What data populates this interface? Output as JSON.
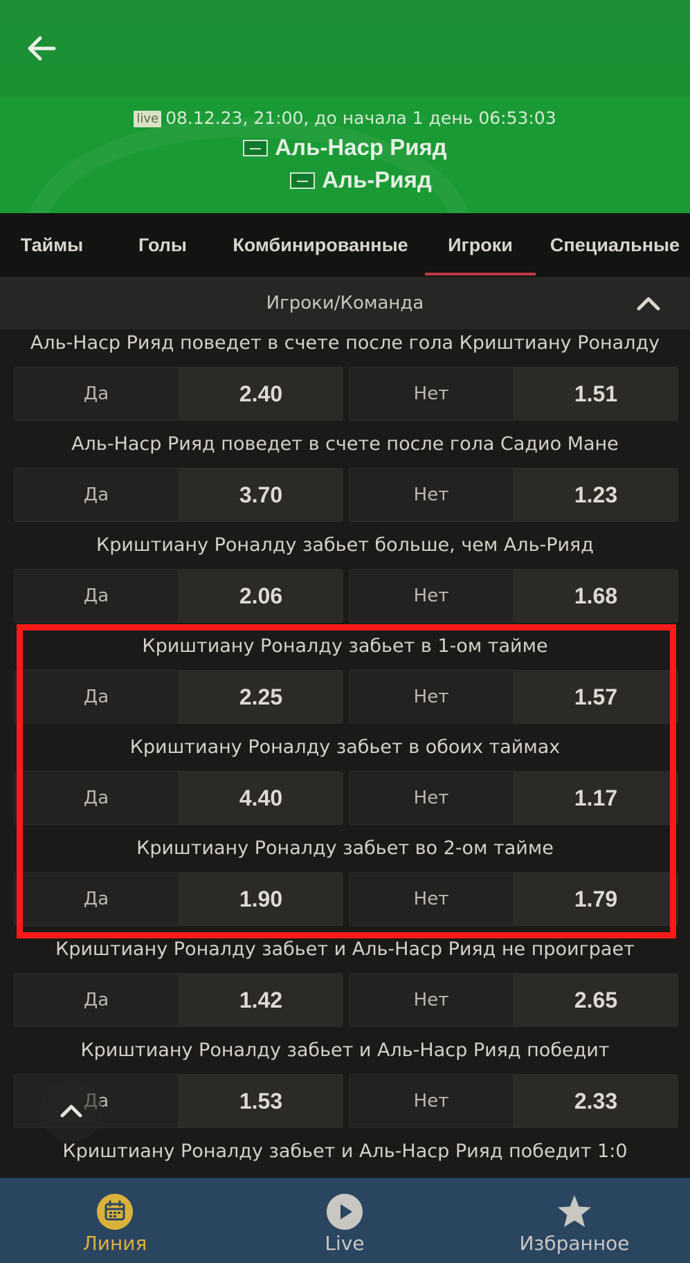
{
  "header": {
    "live_badge": "live",
    "match_time": "08.12.23, 21:00, до начала  1 день  06:53:03",
    "team1": "Аль-Наср Рияд",
    "team2": "Аль-Рияд"
  },
  "tabs": [
    {
      "label": "Таймы"
    },
    {
      "label": "Голы"
    },
    {
      "label": "Комбинированные"
    },
    {
      "label": "Игроки",
      "active": true
    },
    {
      "label": "Специальные"
    }
  ],
  "section": {
    "title": "Игроки/Команда"
  },
  "markets": [
    {
      "title": "Аль-Наср Рияд поведет в счете после гола Криштиану Роналду",
      "yes_label": "Да",
      "yes_odds": "2.40",
      "no_label": "Нет",
      "no_odds": "1.51"
    },
    {
      "title": "Аль-Наср Рияд поведет в счете после гола Садио Мане",
      "yes_label": "Да",
      "yes_odds": "3.70",
      "no_label": "Нет",
      "no_odds": "1.23"
    },
    {
      "title": "Криштиану Роналду забьет больше, чем Аль-Рияд",
      "yes_label": "Да",
      "yes_odds": "2.06",
      "no_label": "Нет",
      "no_odds": "1.68"
    },
    {
      "title": "Криштиану Роналду забьет в 1-ом тайме",
      "yes_label": "Да",
      "yes_odds": "2.25",
      "no_label": "Нет",
      "no_odds": "1.57"
    },
    {
      "title": "Криштиану Роналду забьет в обоих таймах",
      "yes_label": "Да",
      "yes_odds": "4.40",
      "no_label": "Нет",
      "no_odds": "1.17"
    },
    {
      "title": "Криштиану Роналду забьет во 2-ом тайме",
      "yes_label": "Да",
      "yes_odds": "1.90",
      "no_label": "Нет",
      "no_odds": "1.79"
    },
    {
      "title": "Криштиану Роналду забьет и Аль-Наср Рияд не проиграет",
      "yes_label": "Да",
      "yes_odds": "1.42",
      "no_label": "Нет",
      "no_odds": "2.65"
    },
    {
      "title": "Криштиану Роналду забьет и Аль-Наср Рияд победит",
      "yes_label": "Да",
      "yes_odds": "1.53",
      "no_label": "Нет",
      "no_odds": "2.33"
    },
    {
      "title": "Криштиану Роналду забьет и Аль-Наср Рияд победит 1:0"
    }
  ],
  "bottom_nav": [
    {
      "label": "Линия",
      "icon": "calendar-icon",
      "active": true
    },
    {
      "label": "Live",
      "icon": "play-icon"
    },
    {
      "label": "Избранное",
      "icon": "star-icon"
    }
  ],
  "colors": {
    "header_green": "#1a9a34",
    "tab_active_underline": "#c23a45",
    "highlight": "#ff1a1a",
    "nav_active": "#d9b23b",
    "nav_inactive": "#c9c7c2",
    "nav_bg": "#2a4560"
  }
}
